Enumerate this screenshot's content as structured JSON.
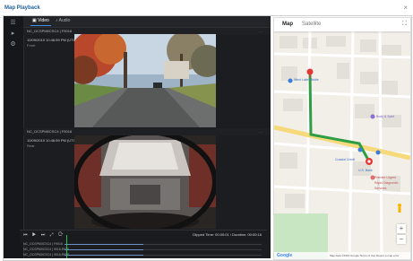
{
  "window": {
    "title": "Map Playback",
    "close_glyph": "×"
  },
  "tabs": [
    {
      "label": "Video"
    },
    {
      "label": "Audio"
    }
  ],
  "cameras": [
    {
      "header": "NC_OCSPM0CSC4 | F9016",
      "timestamp": "10/09/2019 10:46:59 PM (UTC)",
      "sublabel": "Front"
    },
    {
      "header": "NC_OCSPM0CSC4 | F9016",
      "timestamp": "10/09/2019 10:46:59 PM (UTC)",
      "sublabel": "Rear"
    }
  ],
  "controls": {
    "buttons": "⏮ ▶ ⏭ ⤢ ⟳",
    "time": "Clipped Time: 00:00:01 / Duration: 00:00:16"
  },
  "tracks": [
    {
      "label": "NC_OCSPM0CSC4 | F9016"
    },
    {
      "label": "NC_OCSPM0CSC4 | 9016-RIDE"
    },
    {
      "label": "NC_OCSPM0CSC4 | 9016-RIDE"
    }
  ],
  "map": {
    "tabs": [
      {
        "label": "Map"
      },
      {
        "label": "Satellite"
      }
    ],
    "pois": [
      "West Lake Middle",
      "Body & Spirit",
      "Coastal Credit",
      "U.S. Bank",
      "Premier Urgent",
      "Rapid Diagnostic",
      "Services"
    ],
    "footer": "Map data ©2019 Google  Terms of Use  Report a map error",
    "google": "Google",
    "zoom_in": "+",
    "zoom_out": "−",
    "fullscreen": "⛶"
  },
  "colors": {
    "route": "#2e9e44",
    "marker_red": "#e53935",
    "accent": "#1f5f9e"
  }
}
